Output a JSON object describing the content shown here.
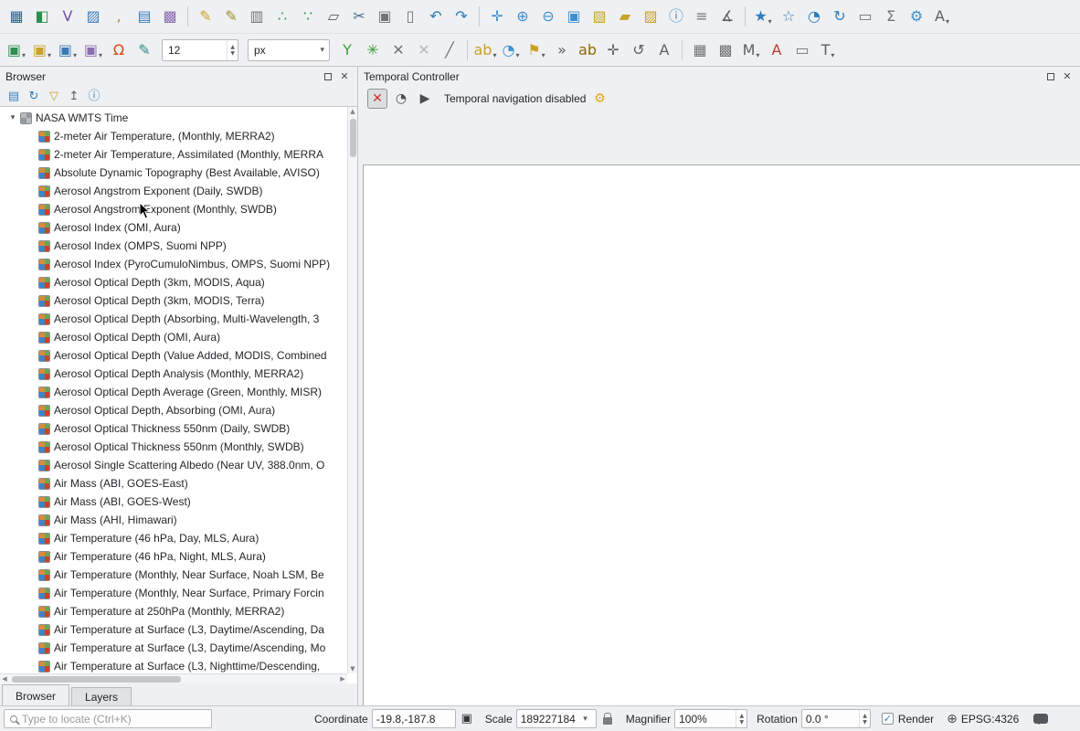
{
  "window": {
    "bg": "#eff0f1",
    "accent": "#3daee9"
  },
  "toolbar_row1": {
    "items": [
      {
        "name": "data-source-manager-icon",
        "glyph": "▦",
        "color": "#28608f"
      },
      {
        "name": "manage-layers-icon",
        "glyph": "◧",
        "color": "#2d8f4e"
      },
      {
        "name": "add-vector-layer-icon",
        "glyph": "V",
        "color": "#6b4fa0"
      },
      {
        "name": "add-raster-layer-icon",
        "glyph": "▨",
        "color": "#3f7fbf"
      },
      {
        "name": "add-delimited-text-layer-icon",
        "glyph": ",",
        "color": "#c77f2e"
      },
      {
        "name": "add-postgis-layer-icon",
        "glyph": "▤",
        "color": "#3a7ab8"
      },
      {
        "name": "add-wms-layer-icon",
        "glyph": "▩",
        "color": "#8a6db1"
      },
      {
        "type": "sep"
      },
      {
        "name": "current-edits-icon",
        "glyph": "✎",
        "color": "#c9a227"
      },
      {
        "name": "toggle-editing-icon",
        "glyph": "✎",
        "color": "#9a8f2a"
      },
      {
        "name": "save-layer-edits-icon",
        "glyph": "▥",
        "color": "#6f7477"
      },
      {
        "name": "digitize-point-icon",
        "glyph": "∴",
        "color": "#2d8f4e"
      },
      {
        "name": "digitize-shape-icon",
        "glyph": "∵",
        "color": "#2d8f4e"
      },
      {
        "name": "vertex-tool-icon",
        "glyph": "▱",
        "color": "#5b6064"
      },
      {
        "name": "cut-features-icon",
        "glyph": "✂",
        "color": "#4a6b8a"
      },
      {
        "name": "copy-features-icon",
        "glyph": "▣",
        "color": "#6f7477"
      },
      {
        "name": "paste-features-icon",
        "glyph": "▯",
        "color": "#6f7477"
      },
      {
        "name": "undo-icon",
        "glyph": "↶",
        "color": "#2e7dbd"
      },
      {
        "name": "redo-icon",
        "glyph": "↷",
        "color": "#2e7dbd"
      },
      {
        "type": "sep"
      },
      {
        "name": "pan-map-icon",
        "glyph": "✛",
        "color": "#3d8fd1"
      },
      {
        "name": "zoom-in-icon",
        "glyph": "⊕",
        "color": "#3d8fd1"
      },
      {
        "name": "zoom-out-icon",
        "glyph": "⊖",
        "color": "#3d8fd1"
      },
      {
        "name": "zoom-full-icon",
        "glyph": "▣",
        "color": "#3d8fd1"
      },
      {
        "name": "select-features-icon",
        "glyph": "▧",
        "color": "#c9a227"
      },
      {
        "name": "select-polygon-icon",
        "glyph": "▰",
        "color": "#c9a227"
      },
      {
        "name": "deselect-features-icon",
        "glyph": "▨",
        "color": "#c9a227"
      },
      {
        "name": "identify-features-icon",
        "glyph": "ⓘ",
        "color": "#3d8fd1"
      },
      {
        "name": "open-attribute-table-icon",
        "glyph": "≡",
        "color": "#6f7477"
      },
      {
        "name": "measure-line-icon",
        "glyph": "∡",
        "color": "#5b6064"
      },
      {
        "type": "sep"
      },
      {
        "name": "show-bookmarks-icon",
        "glyph": "★",
        "color": "#2e7dbd",
        "dropdown": true
      },
      {
        "name": "new-bookmark-icon",
        "glyph": "☆",
        "color": "#2e7dbd"
      },
      {
        "name": "temporal-controller-icon",
        "glyph": "◔",
        "color": "#2e7dbd"
      },
      {
        "name": "refresh-map-icon",
        "glyph": "↻",
        "color": "#2e7dbd"
      },
      {
        "name": "new-print-layout-icon",
        "glyph": "▭",
        "color": "#6f7477"
      },
      {
        "name": "show-statistics-icon",
        "glyph": "Σ",
        "color": "#6f7477"
      },
      {
        "name": "processing-toolbox-icon",
        "glyph": "⚙",
        "color": "#3d8fd1"
      },
      {
        "name": "annotations-icon",
        "glyph": "A",
        "color": "#5b6064",
        "dropdown": true
      }
    ]
  },
  "toolbar_row2": {
    "font_size": "12",
    "units": "px",
    "segment1": [
      {
        "name": "new-geopackage-layer-icon",
        "glyph": "▣",
        "color": "#2d8f4e",
        "dropdown": true
      },
      {
        "name": "new-shapefile-layer-icon",
        "glyph": "▣",
        "color": "#c9a227",
        "dropdown": true
      },
      {
        "name": "new-temporary-scratch-layer-icon",
        "glyph": "▣",
        "color": "#3a7ab8",
        "dropdown": true
      },
      {
        "name": "new-virtual-layer-icon",
        "glyph": "▣",
        "color": "#8a6db1",
        "dropdown": true
      },
      {
        "name": "snapping-options-icon",
        "glyph": "Ω",
        "color": "#d9480f"
      },
      {
        "name": "enable-tracing-icon",
        "glyph": "✎",
        "color": "#2e8b8b"
      }
    ],
    "segment2": [
      {
        "name": "digitize-with-curve-icon",
        "glyph": "Y",
        "color": "#3a9e3a"
      },
      {
        "name": "stream-digitizing-icon",
        "glyph": "✳",
        "color": "#3a9e3a"
      },
      {
        "name": "cancel-edits-icon",
        "glyph": "✕",
        "color": "#6f7477"
      },
      {
        "name": "finish-edits-icon",
        "glyph": "✕",
        "color": "#b3b6b9"
      },
      {
        "name": "split-line-icon",
        "glyph": "╱",
        "color": "#6f7477"
      },
      {
        "type": "sep"
      },
      {
        "name": "layer-labeling-icon",
        "glyph": "ab",
        "color": "#c9a227",
        "dropdown": true
      },
      {
        "name": "layer-diagram-icon",
        "glyph": "◔",
        "color": "#3d8fd1",
        "dropdown": true
      },
      {
        "name": "pin-labels-icon",
        "glyph": "⚑",
        "color": "#c9a227",
        "dropdown": true
      },
      {
        "name": "toolbar-extension-chevron-icon",
        "glyph": "»",
        "color": "#5b6064"
      },
      {
        "name": "highlight-pinned-labels-icon",
        "glyph": "ab",
        "color": "#8f6b00"
      },
      {
        "name": "move-label-icon",
        "glyph": "✛",
        "color": "#5b6064"
      },
      {
        "name": "rotate-label-icon",
        "glyph": "↺",
        "color": "#5b6064"
      },
      {
        "name": "change-label-properties-icon",
        "glyph": "A",
        "color": "#5b6064"
      },
      {
        "type": "sep"
      },
      {
        "name": "raster-calculator-icon",
        "glyph": "▦",
        "color": "#6f7477"
      },
      {
        "name": "mesh-calculator-icon",
        "glyph": "▩",
        "color": "#6f7477"
      },
      {
        "name": "map-tips-icon",
        "glyph": "M",
        "color": "#5b6064",
        "dropdown": true
      },
      {
        "name": "new-annotation-icon",
        "glyph": "A",
        "color": "#c0392b"
      },
      {
        "name": "html-annotation-icon",
        "glyph": "▭",
        "color": "#6f7477"
      },
      {
        "name": "text-annotation-icon",
        "glyph": "T",
        "color": "#5b6064",
        "dropdown": true
      }
    ]
  },
  "browser_panel": {
    "title": "Browser",
    "toolbar": [
      {
        "name": "add-selected-layers-icon",
        "glyph": "▤",
        "color": "#3f7fbf"
      },
      {
        "name": "refresh-browser-icon",
        "glyph": "↻",
        "color": "#2e7dbd"
      },
      {
        "name": "filter-browser-icon",
        "glyph": "▽",
        "color": "#c9a227"
      },
      {
        "name": "collapse-all-icon",
        "glyph": "↥",
        "color": "#5b6064"
      },
      {
        "name": "properties-widget-icon",
        "glyph": "ⓘ",
        "color": "#2e7dbd"
      }
    ],
    "root_label": "NASA WMTS Time",
    "items": [
      "2-meter Air Temperature, (Monthly, MERRA2)",
      "2-meter Air Temperature, Assimilated (Monthly, MERRA",
      "Absolute Dynamic Topography (Best Available, AVISO)",
      "Aerosol Angstrom Exponent (Daily, SWDB)",
      "Aerosol Angstrom Exponent (Monthly, SWDB)",
      "Aerosol Index (OMI, Aura)",
      "Aerosol Index (OMPS, Suomi NPP)",
      "Aerosol Index (PyroCumuloNimbus, OMPS, Suomi NPP)",
      "Aerosol Optical Depth (3km, MODIS, Aqua)",
      "Aerosol Optical Depth (3km, MODIS, Terra)",
      "Aerosol Optical Depth (Absorbing, Multi-Wavelength, 3",
      "Aerosol Optical Depth (OMI, Aura)",
      "Aerosol Optical Depth (Value Added, MODIS, Combined",
      "Aerosol Optical Depth Analysis (Monthly, MERRA2)",
      "Aerosol Optical Depth Average (Green, Monthly, MISR)",
      "Aerosol Optical Depth, Absorbing (OMI, Aura)",
      "Aerosol Optical Thickness 550nm (Daily, SWDB)",
      "Aerosol Optical Thickness 550nm (Monthly, SWDB)",
      "Aerosol Single Scattering Albedo (Near UV, 388.0nm, O",
      "Air Mass (ABI, GOES-East)",
      "Air Mass (ABI, GOES-West)",
      "Air Mass (AHI, Himawari)",
      "Air Temperature (46 hPa, Day, MLS, Aura)",
      "Air Temperature (46 hPa, Night, MLS, Aura)",
      "Air Temperature (Monthly, Near Surface, Noah LSM, Be",
      "Air Temperature (Monthly, Near Surface, Primary Forcin",
      "Air Temperature at 250hPa (Monthly, MERRA2)",
      "Air Temperature at Surface (L3, Daytime/Ascending, Da",
      "Air Temperature at Surface (L3, Daytime/Ascending, Mo",
      "Air Temperature at Surface (L3, Nighttime/Descending,"
    ]
  },
  "temporal_panel": {
    "title": "Temporal Controller",
    "status_text": "Temporal navigation disabled",
    "buttons": [
      {
        "name": "temporal-navigation-off-icon",
        "glyph": "✕",
        "color": "#d32f2f",
        "pressed": true
      },
      {
        "name": "fixed-range-navigation-icon",
        "glyph": "◔",
        "color": "#4a4e52"
      },
      {
        "name": "animated-navigation-icon",
        "glyph": "▶",
        "color": "#4a4e52"
      }
    ],
    "settings_button": {
      "name": "temporal-settings-icon",
      "glyph": "⚙",
      "color": "#e0a50a"
    }
  },
  "dock_tabs": [
    {
      "label": "Browser",
      "active": true
    },
    {
      "label": "Layers",
      "active": false
    }
  ],
  "statusbar": {
    "locate_placeholder": "Type to locate (Ctrl+K)",
    "coordinate_label": "Coordinate",
    "coordinate_value": "-19.8,-187.8",
    "scale_label": "Scale",
    "scale_value": "189227184",
    "magnifier_label": "Magnifier",
    "magnifier_value": "100%",
    "rotation_label": "Rotation",
    "rotation_value": "0.0 °",
    "render_label": "Render",
    "render_checked": true,
    "crs_label": "EPSG:4326"
  }
}
